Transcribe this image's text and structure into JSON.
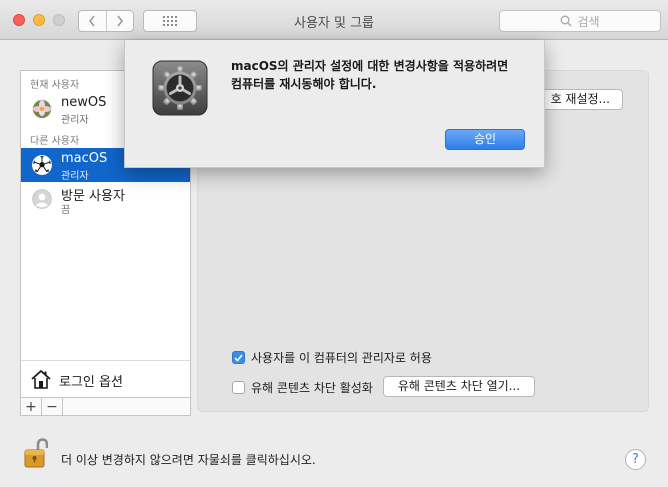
{
  "window": {
    "title": "사용자 및 그룹"
  },
  "search": {
    "placeholder": "검색"
  },
  "sidebar": {
    "current_header": "현재 사용자",
    "others_header": "다른 사용자",
    "users": [
      {
        "name": "newOS",
        "sub": "관리자"
      },
      {
        "name": "macOS",
        "sub": "관리자"
      },
      {
        "name": "방문 사용자",
        "sub": "끔"
      }
    ],
    "login_options": "로그인 옵션",
    "add": "+",
    "remove": "−"
  },
  "main": {
    "reset_password_button": "호 재설정...",
    "allow_admin_label": "사용자를 이 컴퓨터의 관리자로 허용",
    "allow_admin_checked": true,
    "parental_label": "유해 콘텐츠 차단 활성화",
    "parental_checked": false,
    "open_parental_button": "유해 콘텐츠 차단 열기..."
  },
  "footer": {
    "lock_text": "더 이상 변경하지 않으려면 자물쇠를 클릭하십시오.",
    "help": "?"
  },
  "dialog": {
    "message_line1": "macOS의 관리자 설정에 대한 변경사항을 적용하려면",
    "message_line2": "컴퓨터를 재시동해야 합니다.",
    "approve_button": "승인"
  },
  "colors": {
    "selection": "#1166cc",
    "accent": "#2e7de9"
  }
}
